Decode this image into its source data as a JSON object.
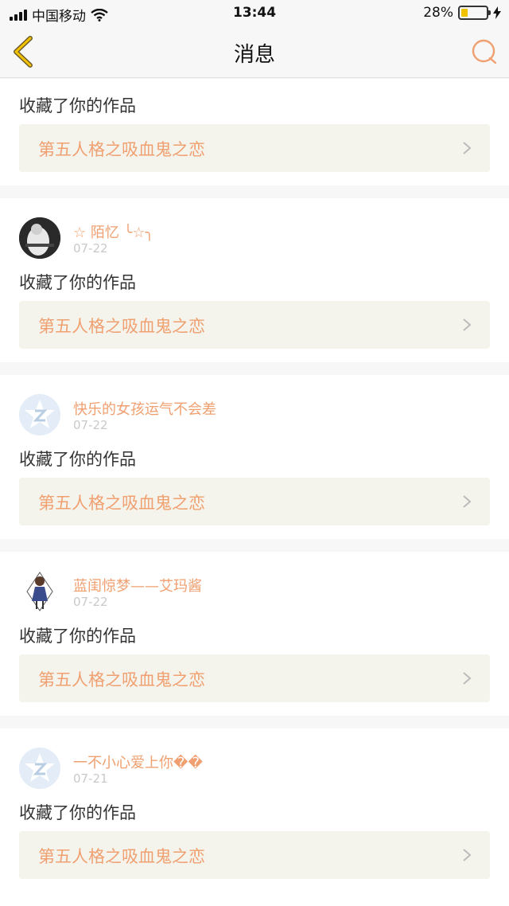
{
  "status_bar": {
    "carrier": "中国移动",
    "time": "13:44",
    "battery": "28%",
    "battery_level": 0.28
  },
  "nav": {
    "title": "消息"
  },
  "messages": [
    {
      "name": "",
      "date": "",
      "action": "收藏了你的作品",
      "work": "第五人格之吸血鬼之恋"
    },
    {
      "name": "☆ 陌忆 ╰☆╮",
      "date": "07-22",
      "action": "收藏了你的作品",
      "work": "第五人格之吸血鬼之恋"
    },
    {
      "name": "快乐的女孩运气不会差",
      "date": "07-22",
      "action": "收藏了你的作品",
      "work": "第五人格之吸血鬼之恋"
    },
    {
      "name": "蓝闺惊梦——艾玛酱",
      "date": "07-22",
      "action": "收藏了你的作品",
      "work": "第五人格之吸血鬼之恋"
    },
    {
      "name": "一不小心爱上你��",
      "date": "07-21",
      "action": "收藏了你的作品",
      "work": "第五人格之吸血鬼之恋"
    }
  ],
  "colors": {
    "accent": "#f0a070",
    "link_bg": "#f4f4ed",
    "date": "#c9c9c9"
  }
}
